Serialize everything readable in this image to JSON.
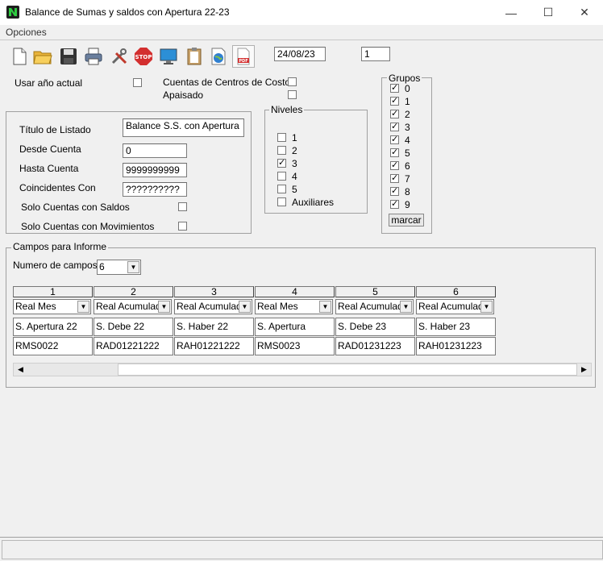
{
  "window": {
    "title": "Balance de Sumas y saldos con Apertura 22-23",
    "minimize": "—",
    "maximize": "☐",
    "close": "✕"
  },
  "menu": {
    "opciones": "Opciones"
  },
  "toolbar": {
    "date": "24/08/23",
    "copies": "1",
    "icons": [
      "new-document-icon",
      "open-folder-icon",
      "save-icon",
      "print-icon",
      "tools-icon",
      "stop-icon",
      "monitor-icon",
      "clipboard-icon",
      "globe-icon",
      "pdf-icon"
    ]
  },
  "options": {
    "usar_anio_actual": "Usar año actual",
    "cuentas_centros_costo": "Cuentas de Centros de Costo",
    "apaisado": "Apaisado"
  },
  "listado": {
    "titulo_label": "Título de Listado",
    "titulo_value": "Balance S.S. con Apertura",
    "desde_label": "Desde Cuenta",
    "desde_value": "0",
    "hasta_label": "Hasta Cuenta",
    "hasta_value": "9999999999",
    "coincidentes_label": "Coincidentes Con",
    "coincidentes_value": "??????????",
    "solo_saldos": "Solo Cuentas con Saldos",
    "solo_movimientos": "Solo Cuentas con Movimientos"
  },
  "niveles": {
    "title": "Niveles",
    "items": [
      {
        "label": "1",
        "checked": false
      },
      {
        "label": "2",
        "checked": false
      },
      {
        "label": "3",
        "checked": true
      },
      {
        "label": "4",
        "checked": false
      },
      {
        "label": "5",
        "checked": false
      },
      {
        "label": "Auxiliares",
        "checked": false
      }
    ]
  },
  "grupos": {
    "title": "Grupos",
    "items": [
      "0",
      "1",
      "2",
      "3",
      "4",
      "5",
      "6",
      "7",
      "8",
      "9"
    ],
    "marcar": "marcar"
  },
  "campos": {
    "title": "Campos para Informe",
    "numero_label": "Numero de campos:",
    "numero_value": "6",
    "columns": [
      {
        "header": "1",
        "type": "Real Mes",
        "label": "S. Apertura 22",
        "code": "RMS0022"
      },
      {
        "header": "2",
        "type": "Real Acumulado",
        "label": "S. Debe 22",
        "code": "RAD01221222"
      },
      {
        "header": "3",
        "type": "Real Acumulado",
        "label": "S. Haber 22",
        "code": "RAH01221222"
      },
      {
        "header": "4",
        "type": "Real Mes",
        "label": "S. Apertura",
        "code": "RMS0023"
      },
      {
        "header": "5",
        "type": "Real Acumulado",
        "label": "S. Debe 23",
        "code": "RAD01231223"
      },
      {
        "header": "6",
        "type": "Real Acumulado",
        "label": "S. Haber 23",
        "code": "RAH01231223"
      }
    ]
  }
}
